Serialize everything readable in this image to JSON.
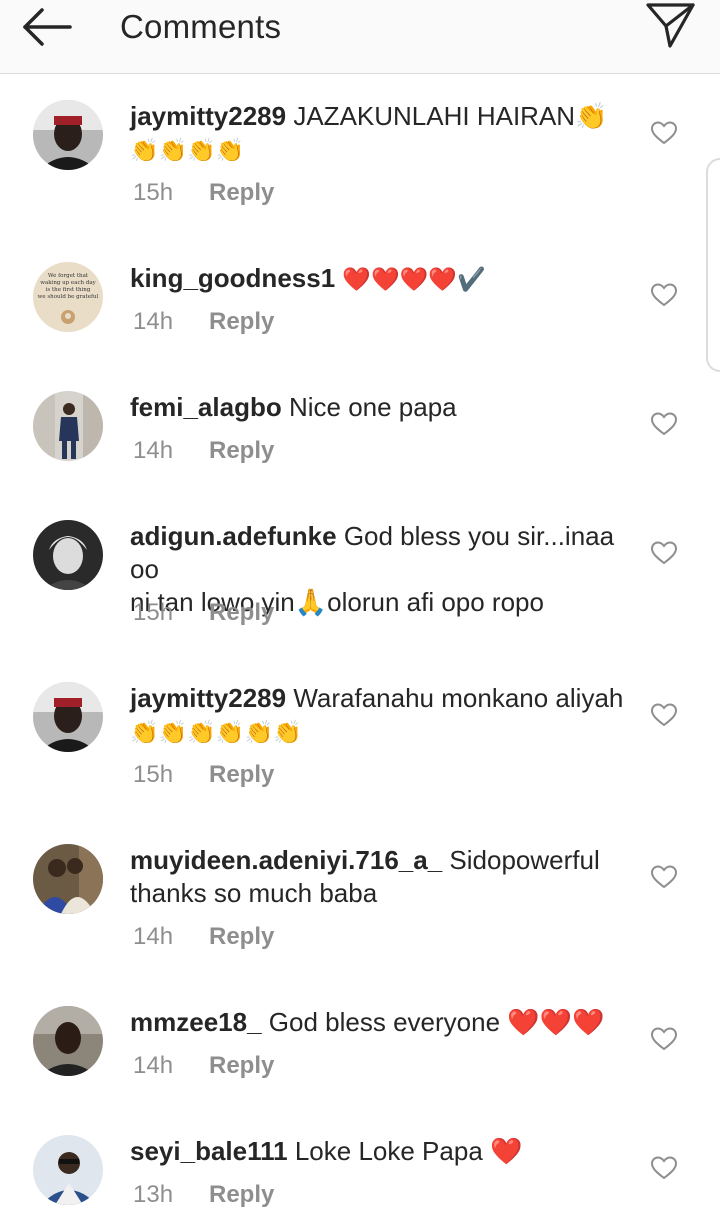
{
  "header": {
    "title": "Comments",
    "back_icon": "arrow-left-icon",
    "send_icon": "paper-plane-icon"
  },
  "reply_label": "Reply",
  "comments": [
    {
      "username": "jaymitty2289",
      "text": "JAZAKUNLAHI HAIRAN👏",
      "text2": "👏👏👏👏",
      "time": "15h"
    },
    {
      "username": "king_goodness1",
      "text": "❤️❤️❤️❤️✔️",
      "time": "14h",
      "avatar_text": "We forget that waking up each day is the first thing we should be grateful for."
    },
    {
      "username": "femi_alagbo",
      "text": "Nice one papa",
      "time": "14h"
    },
    {
      "username": "adigun.adefunke",
      "text": "God bless you sir...inaa  oo",
      "text2": "ni tan lowo yin🙏olorun afi opo ropo",
      "time": "15h"
    },
    {
      "username": "jaymitty2289",
      "text": "Warafanahu monkano aliyah",
      "text2": "👏👏👏👏👏👏",
      "time": "15h"
    },
    {
      "username": "muyideen.adeniyi.716_a_",
      "text": "Sidopowerful",
      "text2": "thanks so much baba",
      "time": "14h"
    },
    {
      "username": "mmzee18_",
      "text": "God bless everyone ❤️❤️❤️",
      "time": "14h"
    },
    {
      "username": "seyi_bale111",
      "text": "Loke Loke Papa ❤️",
      "time": "13h"
    }
  ]
}
